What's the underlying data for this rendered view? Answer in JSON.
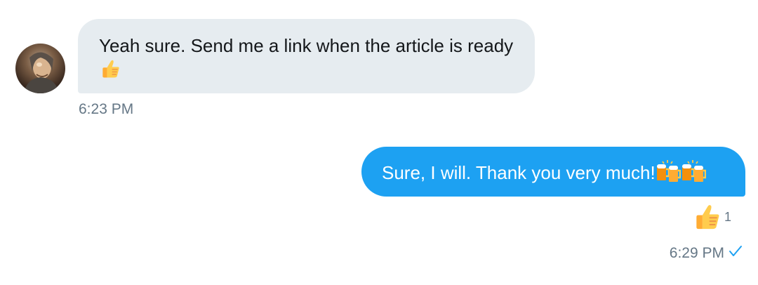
{
  "conversation": {
    "incoming": {
      "text": "Yeah sure. Send me a link when the article is ready",
      "emoji": "thumbs-up",
      "timestamp": "6:23 PM"
    },
    "outgoing": {
      "text": "Sure, I will. Thank you very much!",
      "emojis": [
        "clinking-beer-mugs",
        "clinking-beer-mugs"
      ],
      "reaction": {
        "emoji": "thumbs-up",
        "count": "1"
      },
      "timestamp": "6:29 PM",
      "status_icon": "checkmark-icon"
    }
  },
  "colors": {
    "incoming_bubble": "#e6ecf0",
    "outgoing_bubble": "#1da1f2",
    "timestamp": "#657786",
    "check": "#1da1f2",
    "emoji_yellow": "#ffcc4d"
  }
}
